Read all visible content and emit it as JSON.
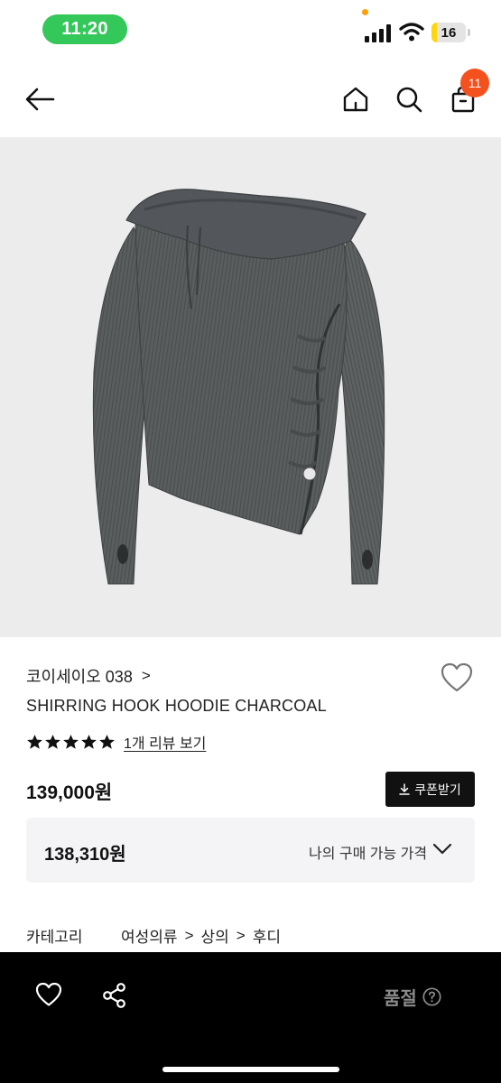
{
  "status_bar": {
    "time": "11:20",
    "battery_level": "16",
    "battery_fraction": 0.16
  },
  "nav": {
    "cart_badge": "11",
    "icons": [
      "back-arrow-icon",
      "home-icon",
      "search-icon",
      "cart-icon"
    ]
  },
  "product": {
    "image": "charcoal ribbed hoodie with side shirring",
    "brand": "코이세이오 038",
    "brand_arrow": ">",
    "name": "SHIRRING HOOK HOODIE CHARCOAL",
    "rating_stars": 5,
    "review_link": "1개 리뷰 보기",
    "price": "139,000원",
    "coupon_button": "쿠폰받기",
    "my_price": {
      "value": "138,310원",
      "label": "나의 구매 가능 가격"
    },
    "category": {
      "label": "카테고리",
      "path": [
        "여성의류",
        "상의",
        "후디"
      ],
      "separator": ">"
    }
  },
  "bottom_bar": {
    "status_label": "품절",
    "icons": [
      "heart-icon",
      "share-icon",
      "help-icon"
    ]
  },
  "colors": {
    "time_pill": "#34c759",
    "badge": "#f4511e",
    "battery": "#ffd60a",
    "bottom_bar": "#000000"
  }
}
